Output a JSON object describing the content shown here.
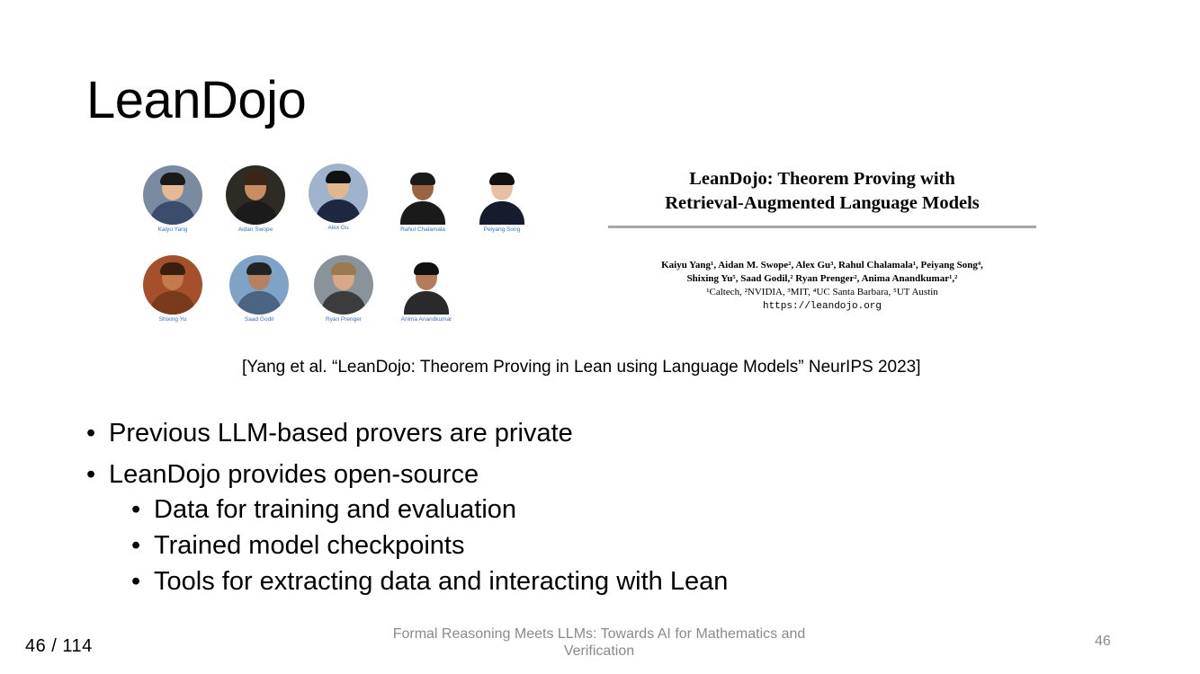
{
  "slide": {
    "title": "LeanDojo",
    "citation": "[Yang et al. “LeanDojo: Theorem Proving in Lean using Language Models” NeurIPS 2023]"
  },
  "authors": [
    {
      "name": "Kaiyu Yang",
      "skin": "#e4b994",
      "hair": "#1a1a1a",
      "shirt": "#3c4c6c",
      "bg": "#7a8aa0"
    },
    {
      "name": "Aidan Swope",
      "skin": "#c98d64",
      "hair": "#3a2516",
      "shirt": "#1b1b1b",
      "bg": "#2e2a24"
    },
    {
      "name": "Alex Gu",
      "skin": "#e2b68f",
      "hair": "#111111",
      "shirt": "#1d2740",
      "bg": "#9fb4cc"
    },
    {
      "name": "Rahul Chalamala",
      "skin": "#9a6442",
      "hair": "#1a1a1a",
      "shirt": "#1a1a1a",
      "bg": "#ffffff"
    },
    {
      "name": "Peiyang Song",
      "skin": "#e6c0a0",
      "hair": "#111111",
      "shirt": "#161c2e",
      "bg": "#ffffff"
    },
    {
      "name": "Shixing Yu",
      "skin": "#c47a4c",
      "hair": "#3a1e10",
      "shirt": "#7a3a1c",
      "bg": "#a5502a"
    },
    {
      "name": "Saad Godil",
      "skin": "#b48262",
      "hair": "#222222",
      "shirt": "#4a6482",
      "bg": "#7fa3c6"
    },
    {
      "name": "Ryan Prenger",
      "skin": "#d9a886",
      "hair": "#9a7a50",
      "shirt": "#3c3c3c",
      "bg": "#8a939a"
    },
    {
      "name": "Anima Anandkumar",
      "skin": "#b47c58",
      "hair": "#111111",
      "shirt": "#2a2a2a",
      "bg": "#ffffff"
    }
  ],
  "paper": {
    "title_line1": "LeanDojo: Theorem Proving with",
    "title_line2": "Retrieval-Augmented Language Models",
    "authors_line1": "Kaiyu Yang¹, Aidan M. Swope², Alex Gu³, Rahul Chalamala¹, Peiyang Song⁴,",
    "authors_line2": "Shixing Yu⁵, Saad Godil,² Ryan Prenger², Anima Anandkumar¹,²",
    "affiliations": "¹Caltech, ²NVIDIA, ³MIT, ⁴UC Santa Barbara, ⁵UT Austin",
    "url": "https://leandojo.org"
  },
  "bullets": {
    "b1": "Previous LLM-based provers are private",
    "b2": "LeanDojo provides open-source",
    "b2_1": "Data for training and evaluation",
    "b2_2": "Trained model checkpoints",
    "b2_3": "Tools for extracting data and interacting with Lean",
    "marker": "•"
  },
  "footer": {
    "page_counter": "46 / 114",
    "talk_title": "Formal Reasoning Meets LLMs: Towards AI for Mathematics and Verification",
    "slide_number": "46"
  }
}
